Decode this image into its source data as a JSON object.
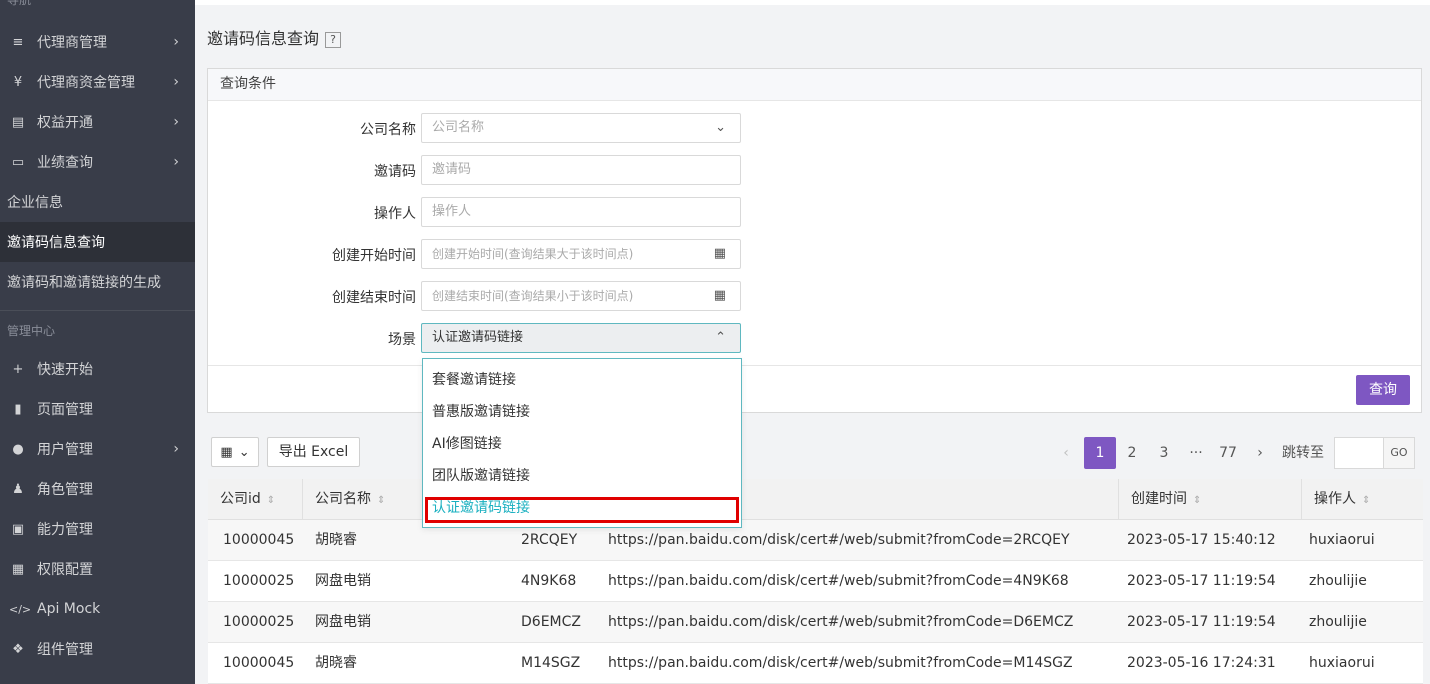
{
  "sidebar": {
    "section_nav": "导航",
    "items": [
      {
        "label": "代理商管理",
        "icon": "≡",
        "has_arrow": true
      },
      {
        "label": "代理商资金管理",
        "icon": "¥",
        "has_arrow": true
      },
      {
        "label": "权益开通",
        "icon": "▤",
        "has_arrow": true
      },
      {
        "label": "业绩查询",
        "icon": "▭",
        "has_arrow": true
      },
      {
        "label": "企业信息"
      },
      {
        "label": "邀请码信息查询",
        "active": true
      },
      {
        "label": "邀请码和邀请链接的生成"
      }
    ],
    "section_admin": "管理中心",
    "admin_items": [
      {
        "label": "快速开始",
        "icon": "+"
      },
      {
        "label": "页面管理",
        "icon": "▮"
      },
      {
        "label": "用户管理",
        "icon": "●",
        "has_arrow": true
      },
      {
        "label": "角色管理",
        "icon": "♟"
      },
      {
        "label": "能力管理",
        "icon": "▣"
      },
      {
        "label": "权限配置",
        "icon": "▦"
      },
      {
        "label": "Api Mock",
        "icon": "</>"
      },
      {
        "label": "组件管理",
        "icon": "❖"
      }
    ],
    "arrow": "›"
  },
  "page": {
    "title": "邀请码信息查询",
    "help": "?"
  },
  "query_panel": {
    "header": "查询条件",
    "fields": {
      "company": {
        "label": "公司名称",
        "placeholder": "公司名称",
        "suffix": "⌄"
      },
      "invite_code": {
        "label": "邀请码",
        "placeholder": "邀请码"
      },
      "operator": {
        "label": "操作人",
        "placeholder": "操作人"
      },
      "start_time": {
        "label": "创建开始时间",
        "placeholder": "创建开始时间(查询结果大于该时间点)",
        "suffix": "▦"
      },
      "end_time": {
        "label": "创建结束时间",
        "placeholder": "创建结束时间(查询结果小于该时间点)",
        "suffix": "▦"
      },
      "scene": {
        "label": "场景",
        "value": "认证邀请码链接",
        "suffix": "⌃"
      }
    },
    "query_button": "查询"
  },
  "scene_dropdown": {
    "options": [
      "套餐邀请链接",
      "普惠版邀请链接",
      "AI修图链接",
      "团队版邀请链接",
      "认证邀请码链接"
    ],
    "selected": "认证邀请码链接"
  },
  "toolbar": {
    "columns_icon": "▦",
    "columns_caret": "⌄",
    "export_label": "导出 Excel"
  },
  "pagination": {
    "prev": "‹",
    "pages": [
      "1",
      "2",
      "3",
      "···",
      "77"
    ],
    "current": "1",
    "next": "›",
    "goto_label": "跳转至",
    "go": "GO"
  },
  "table": {
    "columns": [
      "公司id",
      "公司名称",
      "创建时间",
      "操作人"
    ],
    "sort_icon": "⇕",
    "rows": [
      {
        "company_id": "10000045",
        "company_name": "胡晓睿",
        "invite_code": "2RCQEY",
        "link": "https://pan.baidu.com/disk/cert#/web/submit?fromCode=2RCQEY",
        "created": "2023-05-17 15:40:12",
        "operator": "huxiaorui"
      },
      {
        "company_id": "10000025",
        "company_name": "网盘电销",
        "invite_code": "4N9K68",
        "link": "https://pan.baidu.com/disk/cert#/web/submit?fromCode=4N9K68",
        "created": "2023-05-17 11:19:54",
        "operator": "zhoulijie"
      },
      {
        "company_id": "10000025",
        "company_name": "网盘电销",
        "invite_code": "D6EMCZ",
        "link": "https://pan.baidu.com/disk/cert#/web/submit?fromCode=D6EMCZ",
        "created": "2023-05-17 11:19:54",
        "operator": "zhoulijie"
      },
      {
        "company_id": "10000045",
        "company_name": "胡晓睿",
        "invite_code": "M14SGZ",
        "link": "https://pan.baidu.com/disk/cert#/web/submit?fromCode=M14SGZ",
        "created": "2023-05-16 17:24:31",
        "operator": "huxiaorui"
      }
    ]
  },
  "colors": {
    "sidebar_bg": "#393d49",
    "accent": "#7e57c2",
    "highlight_border": "#e00000",
    "selected_option": "#1ab0c0"
  }
}
